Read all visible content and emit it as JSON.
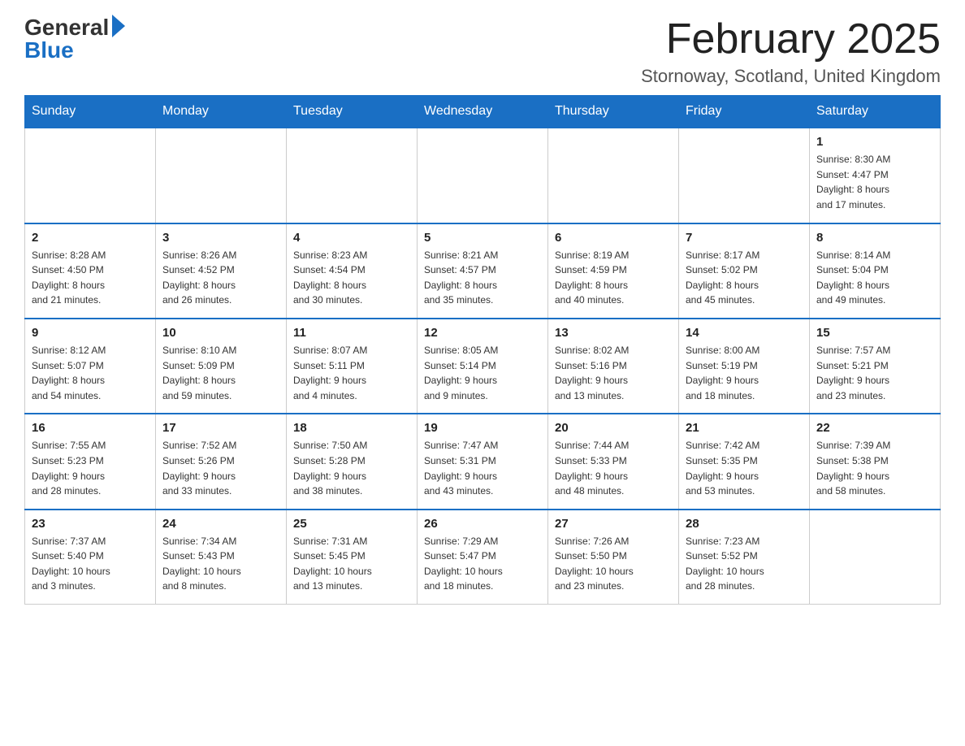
{
  "logo": {
    "general": "General",
    "blue": "Blue"
  },
  "header": {
    "title": "February 2025",
    "location": "Stornoway, Scotland, United Kingdom"
  },
  "weekdays": [
    "Sunday",
    "Monday",
    "Tuesday",
    "Wednesday",
    "Thursday",
    "Friday",
    "Saturday"
  ],
  "weeks": [
    [
      {
        "day": "",
        "info": ""
      },
      {
        "day": "",
        "info": ""
      },
      {
        "day": "",
        "info": ""
      },
      {
        "day": "",
        "info": ""
      },
      {
        "day": "",
        "info": ""
      },
      {
        "day": "",
        "info": ""
      },
      {
        "day": "1",
        "info": "Sunrise: 8:30 AM\nSunset: 4:47 PM\nDaylight: 8 hours\nand 17 minutes."
      }
    ],
    [
      {
        "day": "2",
        "info": "Sunrise: 8:28 AM\nSunset: 4:50 PM\nDaylight: 8 hours\nand 21 minutes."
      },
      {
        "day": "3",
        "info": "Sunrise: 8:26 AM\nSunset: 4:52 PM\nDaylight: 8 hours\nand 26 minutes."
      },
      {
        "day": "4",
        "info": "Sunrise: 8:23 AM\nSunset: 4:54 PM\nDaylight: 8 hours\nand 30 minutes."
      },
      {
        "day": "5",
        "info": "Sunrise: 8:21 AM\nSunset: 4:57 PM\nDaylight: 8 hours\nand 35 minutes."
      },
      {
        "day": "6",
        "info": "Sunrise: 8:19 AM\nSunset: 4:59 PM\nDaylight: 8 hours\nand 40 minutes."
      },
      {
        "day": "7",
        "info": "Sunrise: 8:17 AM\nSunset: 5:02 PM\nDaylight: 8 hours\nand 45 minutes."
      },
      {
        "day": "8",
        "info": "Sunrise: 8:14 AM\nSunset: 5:04 PM\nDaylight: 8 hours\nand 49 minutes."
      }
    ],
    [
      {
        "day": "9",
        "info": "Sunrise: 8:12 AM\nSunset: 5:07 PM\nDaylight: 8 hours\nand 54 minutes."
      },
      {
        "day": "10",
        "info": "Sunrise: 8:10 AM\nSunset: 5:09 PM\nDaylight: 8 hours\nand 59 minutes."
      },
      {
        "day": "11",
        "info": "Sunrise: 8:07 AM\nSunset: 5:11 PM\nDaylight: 9 hours\nand 4 minutes."
      },
      {
        "day": "12",
        "info": "Sunrise: 8:05 AM\nSunset: 5:14 PM\nDaylight: 9 hours\nand 9 minutes."
      },
      {
        "day": "13",
        "info": "Sunrise: 8:02 AM\nSunset: 5:16 PM\nDaylight: 9 hours\nand 13 minutes."
      },
      {
        "day": "14",
        "info": "Sunrise: 8:00 AM\nSunset: 5:19 PM\nDaylight: 9 hours\nand 18 minutes."
      },
      {
        "day": "15",
        "info": "Sunrise: 7:57 AM\nSunset: 5:21 PM\nDaylight: 9 hours\nand 23 minutes."
      }
    ],
    [
      {
        "day": "16",
        "info": "Sunrise: 7:55 AM\nSunset: 5:23 PM\nDaylight: 9 hours\nand 28 minutes."
      },
      {
        "day": "17",
        "info": "Sunrise: 7:52 AM\nSunset: 5:26 PM\nDaylight: 9 hours\nand 33 minutes."
      },
      {
        "day": "18",
        "info": "Sunrise: 7:50 AM\nSunset: 5:28 PM\nDaylight: 9 hours\nand 38 minutes."
      },
      {
        "day": "19",
        "info": "Sunrise: 7:47 AM\nSunset: 5:31 PM\nDaylight: 9 hours\nand 43 minutes."
      },
      {
        "day": "20",
        "info": "Sunrise: 7:44 AM\nSunset: 5:33 PM\nDaylight: 9 hours\nand 48 minutes."
      },
      {
        "day": "21",
        "info": "Sunrise: 7:42 AM\nSunset: 5:35 PM\nDaylight: 9 hours\nand 53 minutes."
      },
      {
        "day": "22",
        "info": "Sunrise: 7:39 AM\nSunset: 5:38 PM\nDaylight: 9 hours\nand 58 minutes."
      }
    ],
    [
      {
        "day": "23",
        "info": "Sunrise: 7:37 AM\nSunset: 5:40 PM\nDaylight: 10 hours\nand 3 minutes."
      },
      {
        "day": "24",
        "info": "Sunrise: 7:34 AM\nSunset: 5:43 PM\nDaylight: 10 hours\nand 8 minutes."
      },
      {
        "day": "25",
        "info": "Sunrise: 7:31 AM\nSunset: 5:45 PM\nDaylight: 10 hours\nand 13 minutes."
      },
      {
        "day": "26",
        "info": "Sunrise: 7:29 AM\nSunset: 5:47 PM\nDaylight: 10 hours\nand 18 minutes."
      },
      {
        "day": "27",
        "info": "Sunrise: 7:26 AM\nSunset: 5:50 PM\nDaylight: 10 hours\nand 23 minutes."
      },
      {
        "day": "28",
        "info": "Sunrise: 7:23 AM\nSunset: 5:52 PM\nDaylight: 10 hours\nand 28 minutes."
      },
      {
        "day": "",
        "info": ""
      }
    ]
  ]
}
